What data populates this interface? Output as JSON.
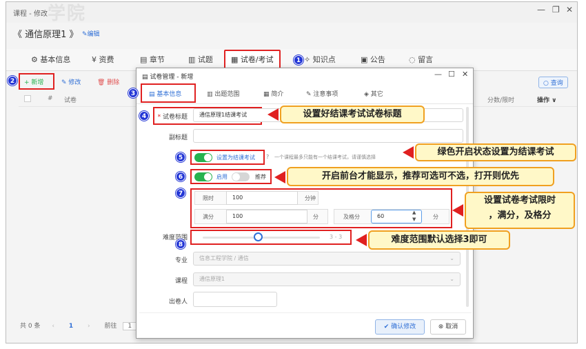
{
  "window": {
    "title": "课程 - 修改",
    "watermark": "学院"
  },
  "course": {
    "name": "《 通信原理1 》",
    "edit_label": "✎编辑"
  },
  "tabs": [
    {
      "label": "基本信息",
      "icon": "gear-icon"
    },
    {
      "label": "资费",
      "icon": "money-icon"
    },
    {
      "label": "章节",
      "icon": "book-icon"
    },
    {
      "label": "试题",
      "icon": "paper-icon"
    },
    {
      "label": "试卷/考试",
      "icon": "exam-icon"
    },
    {
      "label": "知识点",
      "icon": "bulb-icon"
    },
    {
      "label": "公告",
      "icon": "notice-icon"
    },
    {
      "label": "留言",
      "icon": "message-icon"
    }
  ],
  "toolbar": {
    "add": "+ 新增",
    "edit": "✎ 修改",
    "delete": "🗑 删除",
    "query": "○ 查询"
  },
  "table": {
    "col_index": "#",
    "col_name": "试卷",
    "col_score": "分数/限时",
    "col_ops": "操作 ∨"
  },
  "pager": {
    "total": "共 0 条",
    "page": "1",
    "goto": "前往",
    "goto_val": "1"
  },
  "dialog": {
    "title": "试卷管理 - 新增",
    "tabs": [
      "基本信息",
      "出题范围",
      "简介",
      "注意事项",
      "其它"
    ],
    "title_label": "试卷标题",
    "title_value": "通信原理1结课考试",
    "subtitle_label": "副标题",
    "final_exam_label": "设置为结课考试",
    "final_exam_hint": "一个课程最多只能有一个结课考试，请谨慎选择",
    "enable_label": "启用",
    "recommend_label": "推荐",
    "limit_label": "限时",
    "limit_value": "100",
    "limit_unit": "分钟",
    "full_label": "满分",
    "full_value": "100",
    "full_unit": "分",
    "pass_label": "及格分",
    "pass_value": "60",
    "pass_unit": "分",
    "difficulty_label": "难度范围",
    "difficulty_value": "3 - 3",
    "major_label": "专业",
    "major_value": "信息工程学院 / 通信",
    "course_label": "课程",
    "course_value": "通信原理1",
    "author_label": "出卷人",
    "confirm": "确认修改",
    "cancel": "取消"
  },
  "badges": [
    "1",
    "2",
    "3",
    "4",
    "5",
    "6",
    "7",
    "8"
  ],
  "callouts": {
    "c4": "设置好结课考试试卷标题",
    "c5": "绿色开启状态设置为结课考试",
    "c6": "开启前台才能显示，推荐可选可不选，打开则优先",
    "c7a": "设置试卷考试限时",
    "c7b": "，满分，及格分",
    "c8": "难度范围默认选择3即可"
  },
  "colors": {
    "accent": "#2f6fd6",
    "highlight": "#e02020",
    "toggle_on": "#27b24f",
    "badge": "#2336d6",
    "callout_bg": "#fff8c8"
  }
}
